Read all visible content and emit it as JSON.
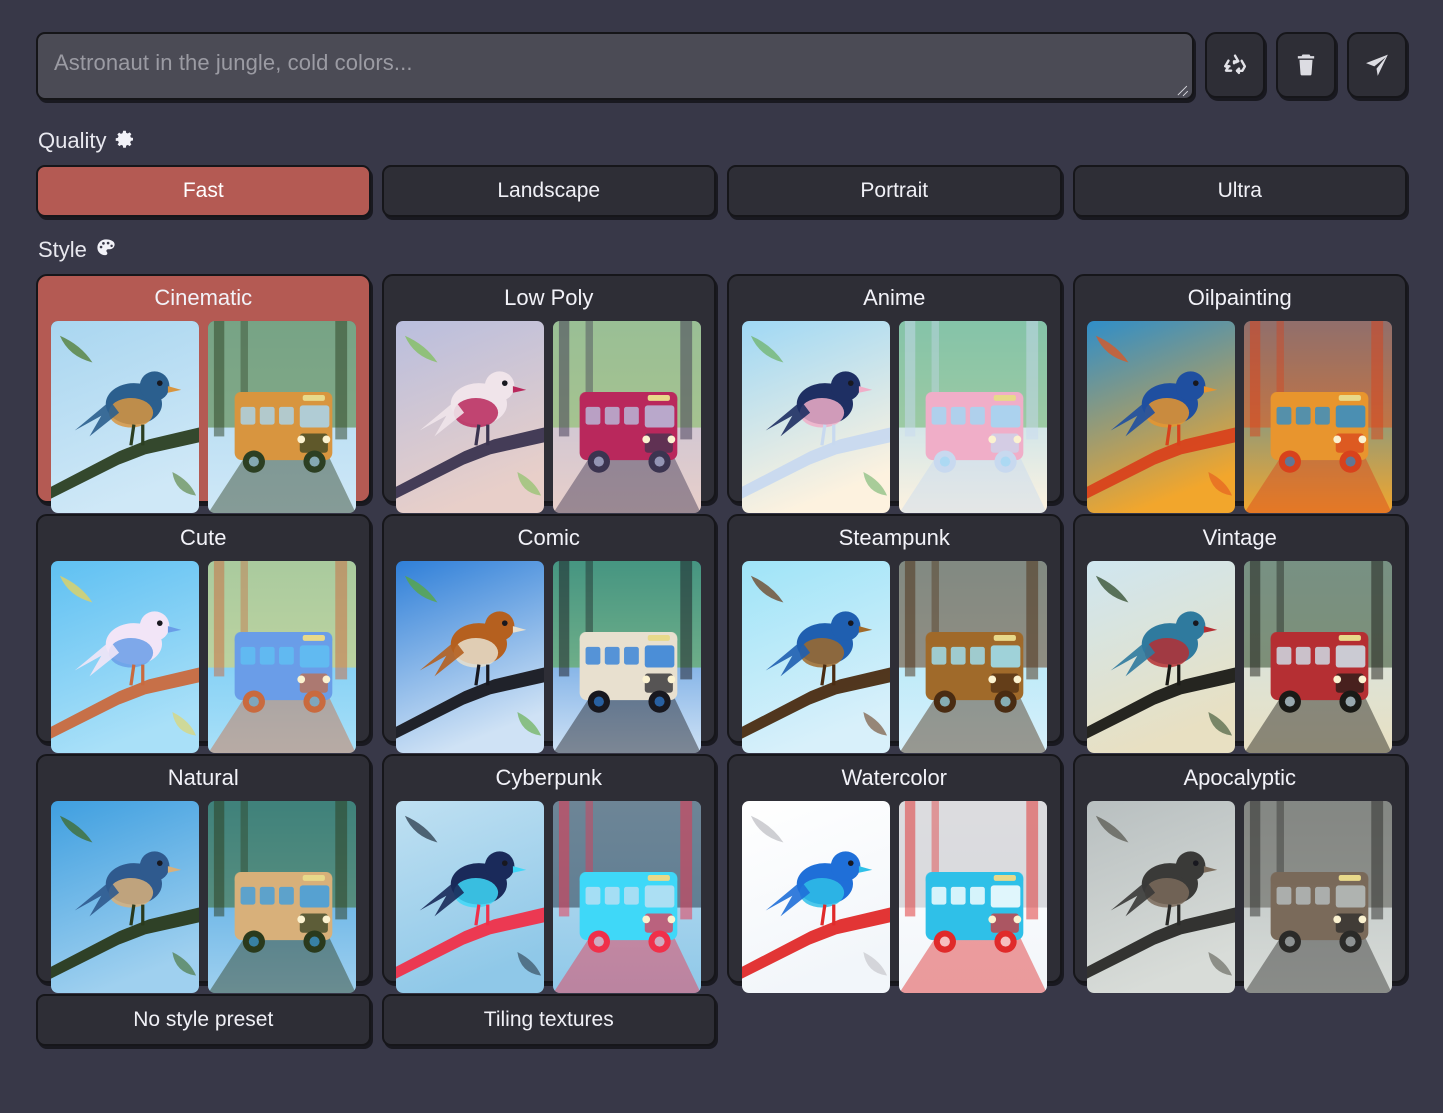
{
  "prompt": {
    "placeholder": "Astronaut in the jungle, cold colors...",
    "value": ""
  },
  "toolbar": {
    "recycle_icon": "recycle-icon",
    "delete_icon": "trash-icon",
    "send_icon": "send-icon"
  },
  "quality": {
    "label": "Quality",
    "icon": "gear-icon",
    "selected": "Fast",
    "options": [
      {
        "label": "Fast",
        "selected": true
      },
      {
        "label": "Landscape",
        "selected": false
      },
      {
        "label": "Portrait",
        "selected": false
      },
      {
        "label": "Ultra",
        "selected": false
      }
    ]
  },
  "style": {
    "label": "Style",
    "icon": "palette-icon",
    "selected": "Cinematic",
    "cards": [
      {
        "label": "Cinematic",
        "selected": true,
        "thumb_a": "bird-cinematic",
        "thumb_b": "bus-cinematic"
      },
      {
        "label": "Low Poly",
        "selected": false,
        "thumb_a": "bird-lowpoly",
        "thumb_b": "bus-lowpoly"
      },
      {
        "label": "Anime",
        "selected": false,
        "thumb_a": "bird-anime",
        "thumb_b": "bus-anime"
      },
      {
        "label": "Oilpainting",
        "selected": false,
        "thumb_a": "bird-oilpainting",
        "thumb_b": "bus-oilpainting"
      },
      {
        "label": "Cute",
        "selected": false,
        "thumb_a": "bird-cute",
        "thumb_b": "bus-cute"
      },
      {
        "label": "Comic",
        "selected": false,
        "thumb_a": "bird-comic",
        "thumb_b": "bus-comic"
      },
      {
        "label": "Steampunk",
        "selected": false,
        "thumb_a": "bird-steampunk",
        "thumb_b": "bus-steampunk"
      },
      {
        "label": "Vintage",
        "selected": false,
        "thumb_a": "bird-vintage",
        "thumb_b": "bus-vintage"
      },
      {
        "label": "Natural",
        "selected": false,
        "thumb_a": "bird-natural",
        "thumb_b": "bus-natural"
      },
      {
        "label": "Cyberpunk",
        "selected": false,
        "thumb_a": "bird-cyberpunk",
        "thumb_b": "bus-cyberpunk"
      },
      {
        "label": "Watercolor",
        "selected": false,
        "thumb_a": "bird-watercolor",
        "thumb_b": "bus-watercolor"
      },
      {
        "label": "Apocalyptic",
        "selected": false,
        "thumb_a": "bird-apocalyptic",
        "thumb_b": "bus-apocalyptic"
      }
    ]
  },
  "presets": [
    {
      "label": "No style preset"
    },
    {
      "label": "Tiling textures"
    }
  ],
  "colors": {
    "page_background": "#383848",
    "card_background": "#2e2e36",
    "accent_selected": "#b45a53",
    "input_background": "#4b4b55",
    "border": "#16161a",
    "text": "#f0f0f6",
    "placeholder_text": "#9b9ba3"
  }
}
